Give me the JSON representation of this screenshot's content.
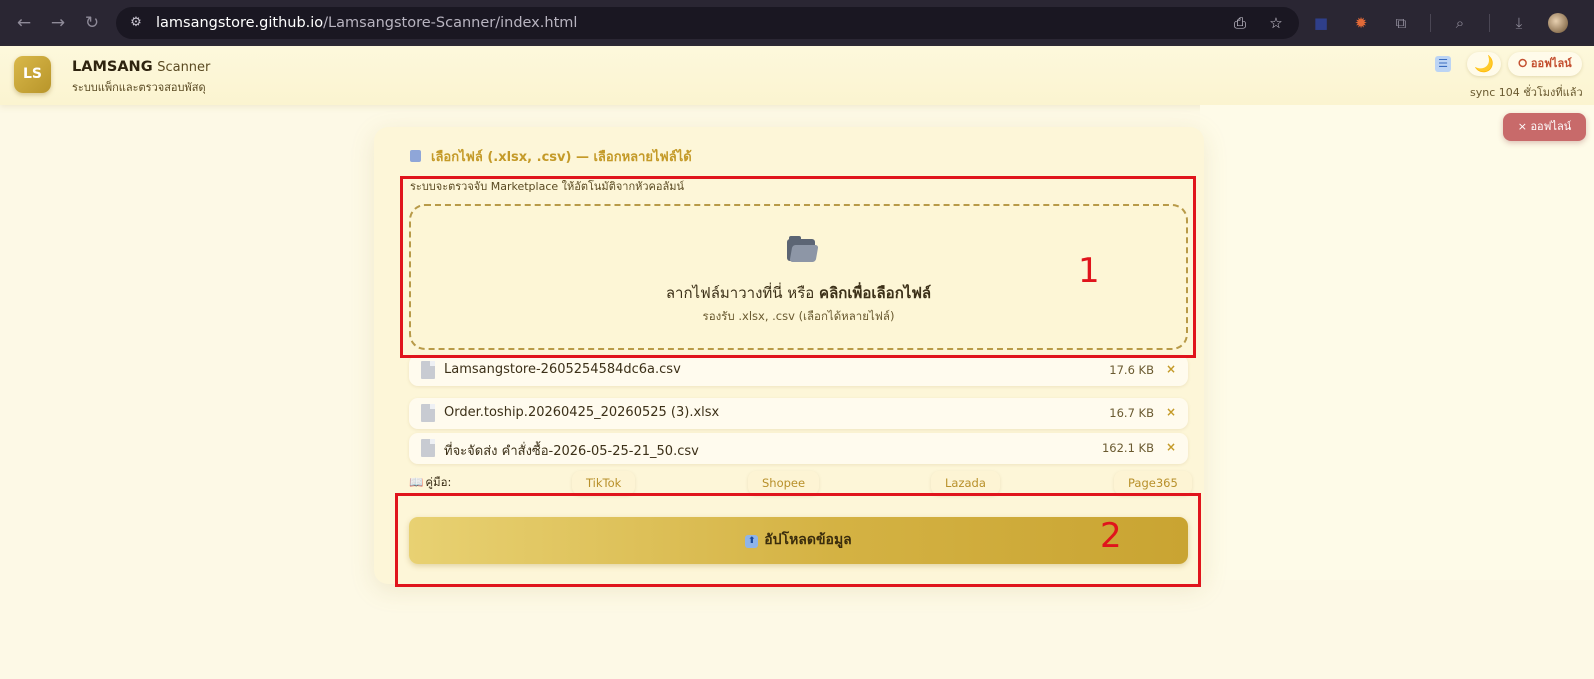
{
  "browser": {
    "url_host": "lamsangstore.github.io",
    "url_path": "/Lamsangstore-Scanner/index.html"
  },
  "header": {
    "logo_text": "LS",
    "brand_name": "LAMSANG",
    "brand_suffix": "Scanner",
    "tagline": "ระบบแพ็กและตรวจสอบพัสดุ",
    "theme_icon": "🌙",
    "offline_label": "⭘ ออฟไลน์",
    "sync_text": "sync 104 ชั่วโมงที่แล้ว"
  },
  "toast": {
    "offline_label": "× ออฟไลน์"
  },
  "card": {
    "title": "เลือกไฟล์ (.xlsx, .csv) — เลือกหลายไฟล์ได้",
    "note": "ระบบจะตรวจจับ Marketplace ให้อัตโนมัติจากหัวคอลัมน์",
    "dropzone": {
      "text_prefix": "ลากไฟล์มาวางที่นี่ หรือ ",
      "text_bold": "คลิกเพื่อเลือกไฟล์",
      "subtext": "รองรับ .xlsx, .csv (เลือกได้หลายไฟล์)"
    },
    "files": [
      {
        "name": "Lamsangstore-2605254584dc6a.csv",
        "size": "17.6 KB",
        "remove": "×"
      },
      {
        "name": "Order.toship.20260425_20260525 (3).xlsx",
        "size": "16.7 KB",
        "remove": "×"
      },
      {
        "name": "ที่จะจัดส่ง คำสั่งซื้อ-2026-05-25-21_50.csv",
        "size": "162.1 KB",
        "remove": "×"
      }
    ],
    "guide_label": "คู่มือ:",
    "guides": [
      "TikTok",
      "Shopee",
      "Lazada",
      "Page365"
    ],
    "upload_label": "อัปโหลดข้อมูล"
  },
  "annotations": {
    "label_1": "1",
    "label_2": "2"
  },
  "colors": {
    "accent": "#c49a28",
    "highlight": "#e0141c",
    "toast": "#c86a6a"
  }
}
